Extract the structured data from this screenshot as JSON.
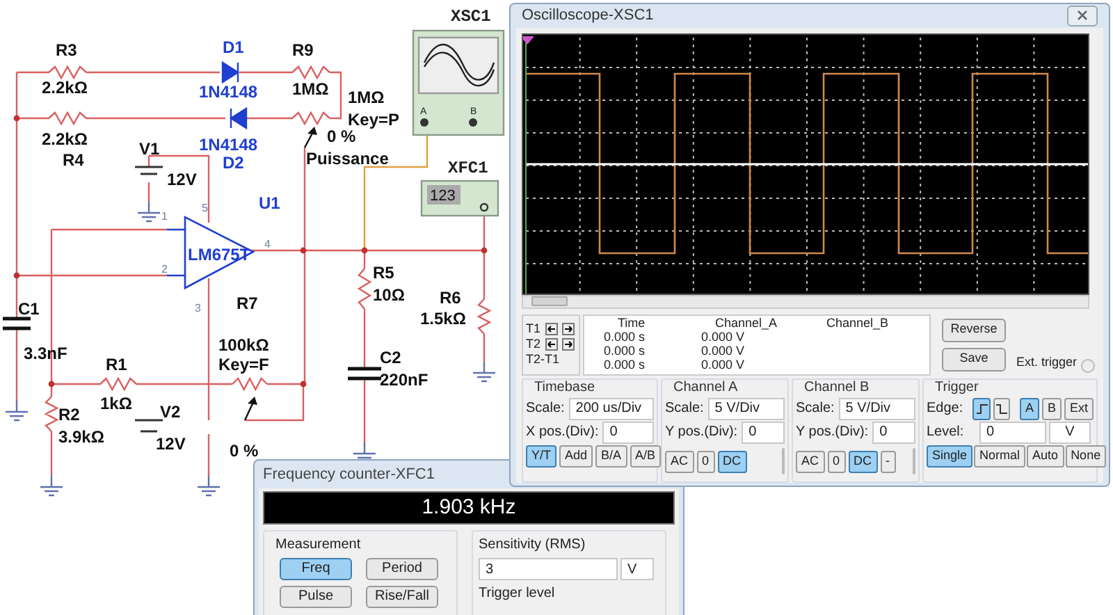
{
  "schematic": {
    "labels": [
      {
        "text": "R3",
        "kind": "ref"
      },
      {
        "text": "D1",
        "kind": "part"
      },
      {
        "text": "R9",
        "kind": "ref"
      },
      {
        "text": "2.2kΩ",
        "kind": "ref"
      },
      {
        "text": "1N4148",
        "kind": "part"
      },
      {
        "text": "1MΩ",
        "kind": "ref"
      },
      {
        "text": "1MΩ",
        "kind": "ref"
      },
      {
        "text": "Key=P",
        "kind": "ref"
      },
      {
        "text": "2.2kΩ",
        "kind": "ref"
      },
      {
        "text": "0 %",
        "kind": "ref"
      },
      {
        "text": "V1",
        "kind": "ref"
      },
      {
        "text": "1N4148",
        "kind": "part"
      },
      {
        "text": "R4",
        "kind": "ref"
      },
      {
        "text": "D2",
        "kind": "part"
      },
      {
        "text": "Puissance",
        "kind": "ref"
      },
      {
        "text": "12V",
        "kind": "ref"
      },
      {
        "text": "U1",
        "kind": "part"
      },
      {
        "text": "LM675T",
        "kind": "part"
      },
      {
        "text": "R7",
        "kind": "ref"
      },
      {
        "text": "C1",
        "kind": "ref"
      },
      {
        "text": "R5",
        "kind": "ref"
      },
      {
        "text": "10Ω",
        "kind": "ref"
      },
      {
        "text": "R6",
        "kind": "ref"
      },
      {
        "text": "1.5kΩ",
        "kind": "ref"
      },
      {
        "text": "3.3nF",
        "kind": "ref"
      },
      {
        "text": "100kΩ",
        "kind": "ref"
      },
      {
        "text": "R1",
        "kind": "ref"
      },
      {
        "text": "Key=F",
        "kind": "ref"
      },
      {
        "text": "C2",
        "kind": "ref"
      },
      {
        "text": "1kΩ",
        "kind": "ref"
      },
      {
        "text": "220nF",
        "kind": "ref"
      },
      {
        "text": "R2",
        "kind": "ref"
      },
      {
        "text": "3.9kΩ",
        "kind": "ref"
      },
      {
        "text": "V2",
        "kind": "ref"
      },
      {
        "text": "12V",
        "kind": "ref"
      },
      {
        "text": "0 %",
        "kind": "ref"
      },
      {
        "text": "5",
        "kind": "pin"
      },
      {
        "text": "1",
        "kind": "pin"
      },
      {
        "text": "4",
        "kind": "pin"
      },
      {
        "text": "2",
        "kind": "pin"
      },
      {
        "text": "3",
        "kind": "pin"
      },
      {
        "text": "XSC1",
        "kind": "instrument"
      },
      {
        "text": "XFC1",
        "kind": "instrument"
      },
      {
        "text": "A",
        "kind": "terminal"
      },
      {
        "text": "B",
        "kind": "terminal"
      },
      {
        "text": "123",
        "kind": "readout"
      }
    ]
  },
  "oscilloscope": {
    "title": "Oscilloscope-XSC1",
    "cursors": [
      {
        "label": "T1",
        "arrows": true
      },
      {
        "label": "T2",
        "arrows": true
      },
      {
        "label": "T2-T1",
        "arrows": false
      }
    ],
    "readout": {
      "columns": [
        "Time",
        "Channel_A",
        "Channel_B"
      ],
      "rows": [
        [
          "0.000 s",
          "0.000 V"
        ],
        [
          "0.000 s",
          "0.000 V"
        ],
        [
          "0.000 s",
          "0.000 V"
        ]
      ]
    },
    "buttons": [
      "Reverse",
      "Save"
    ],
    "ext_trigger": "Ext. trigger",
    "timebase": {
      "title": "Timebase",
      "fields": [
        {
          "label": "Scale:",
          "value": "200 us/Div"
        },
        {
          "label": "X pos.(Div):",
          "value": "0"
        }
      ],
      "modes": [
        {
          "label": "Y/T",
          "selected": true
        },
        {
          "label": "Add",
          "selected": false
        },
        {
          "label": "B/A",
          "selected": false
        },
        {
          "label": "A/B",
          "selected": false
        }
      ]
    },
    "channels": [
      {
        "title": "Channel A",
        "fields": [
          {
            "label": "Scale:",
            "value": "5  V/Div"
          },
          {
            "label": "Y pos.(Div):",
            "value": "0"
          }
        ],
        "coupling": [
          {
            "label": "AC",
            "selected": false
          },
          {
            "label": "0",
            "selected": false
          },
          {
            "label": "DC",
            "selected": true
          }
        ]
      },
      {
        "title": "Channel B",
        "fields": [
          {
            "label": "Scale:",
            "value": "5  V/Div"
          },
          {
            "label": "Y pos.(Div):",
            "value": "0"
          }
        ],
        "coupling": [
          {
            "label": "AC",
            "selected": false
          },
          {
            "label": "0",
            "selected": false
          },
          {
            "label": "DC",
            "selected": true
          },
          {
            "label": "-",
            "selected": false
          }
        ]
      }
    ],
    "trigger": {
      "title": "Trigger",
      "edge_label": "Edge:",
      "edges": [
        {
          "kind": "rising",
          "selected": true
        },
        {
          "kind": "falling",
          "selected": false
        }
      ],
      "sources": [
        {
          "label": "A",
          "selected": true
        },
        {
          "label": "B",
          "selected": false
        },
        {
          "label": "Ext",
          "selected": false
        }
      ],
      "level_label": "Level:",
      "level_value": "0",
      "level_unit": "V",
      "types": [
        {
          "label": "Single",
          "selected": true
        },
        {
          "label": "Normal",
          "selected": false
        },
        {
          "label": "Auto",
          "selected": false
        },
        {
          "label": "None",
          "selected": false
        }
      ]
    }
  },
  "frequency_counter": {
    "title": "Frequency counter-XFC1",
    "display": "1.903 kHz",
    "measurement": {
      "title": "Measurement",
      "buttons": [
        {
          "label": "Freq",
          "selected": true
        },
        {
          "label": "Period",
          "selected": false
        },
        {
          "label": "Pulse",
          "selected": false
        },
        {
          "label": "Rise/Fall",
          "selected": false
        }
      ]
    },
    "sensitivity": {
      "title": "Sensitivity (RMS)",
      "value": "3",
      "unit": "V"
    },
    "trigger_level": {
      "title": "Trigger level"
    }
  }
}
